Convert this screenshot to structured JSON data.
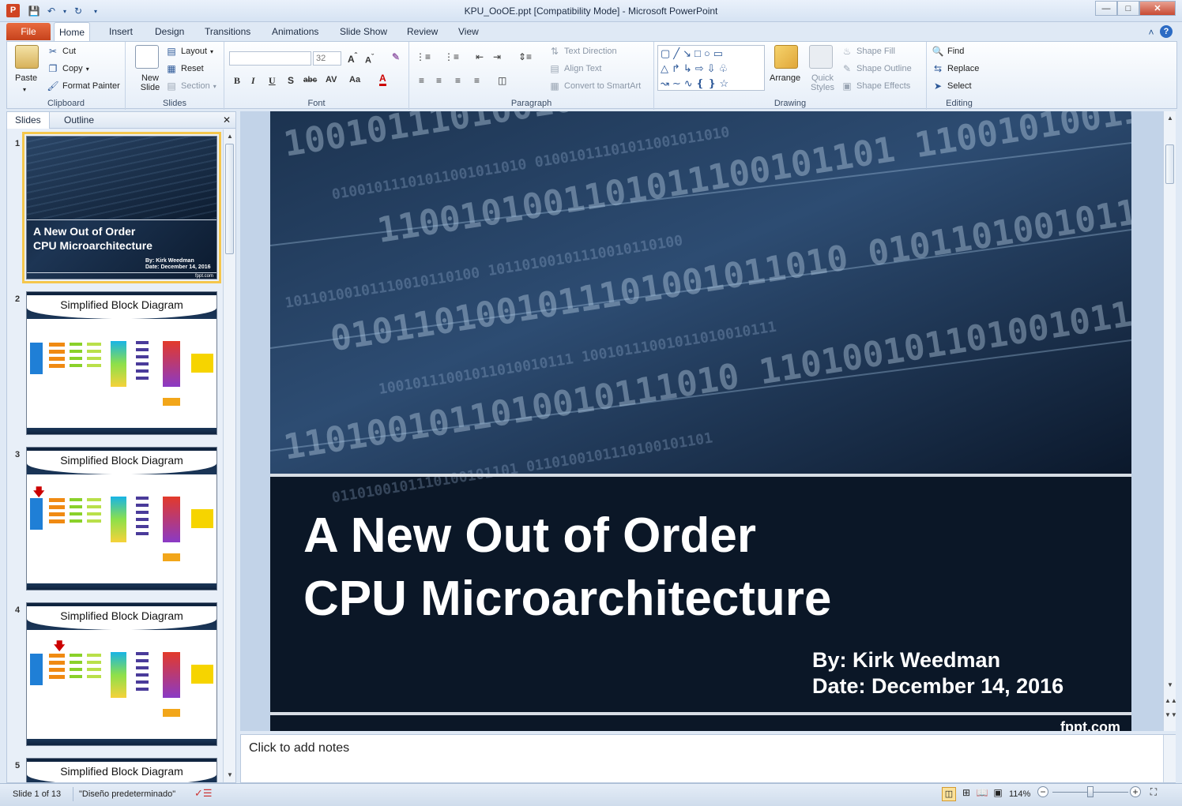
{
  "window": {
    "title": "KPU_OoOE.ppt [Compatibility Mode] - Microsoft PowerPoint",
    "app_letter": "P"
  },
  "tabs": [
    "File",
    "Home",
    "Insert",
    "Design",
    "Transitions",
    "Animations",
    "Slide Show",
    "Review",
    "View"
  ],
  "ribbon": {
    "clipboard": {
      "label": "Clipboard",
      "paste": "Paste",
      "cut": "Cut",
      "copy": "Copy",
      "format_painter": "Format Painter"
    },
    "slides": {
      "label": "Slides",
      "new_slide": "New Slide",
      "layout": "Layout",
      "reset": "Reset",
      "section": "Section"
    },
    "font": {
      "label": "Font",
      "size": "32"
    },
    "paragraph": {
      "label": "Paragraph",
      "text_direction": "Text Direction",
      "align_text": "Align Text",
      "convert_smartart": "Convert to SmartArt"
    },
    "drawing": {
      "label": "Drawing",
      "arrange": "Arrange",
      "quick_styles": "Quick Styles",
      "shape_fill": "Shape Fill",
      "shape_outline": "Shape Outline",
      "shape_effects": "Shape Effects"
    },
    "editing": {
      "label": "Editing",
      "find": "Find",
      "replace": "Replace",
      "select": "Select"
    }
  },
  "left_panel": {
    "tab_slides": "Slides",
    "tab_outline": "Outline",
    "thumbnails": [
      {
        "num": "1",
        "title": "A  New Out of Order",
        "subtitle": "CPU Microarchitecture",
        "by": "By:  Kirk Weedman",
        "date": "Date:  December 14, 2016",
        "brand": "fppt.com"
      },
      {
        "num": "2",
        "title": "Simplified Block Diagram"
      },
      {
        "num": "3",
        "title": "Simplified Block Diagram"
      },
      {
        "num": "4",
        "title": "Simplified Block Diagram"
      },
      {
        "num": "5",
        "title": "Simplified Block Diagram"
      }
    ]
  },
  "slide": {
    "title_line1": "A New Out of Order",
    "title_line2": "CPU Microarchitecture",
    "by": "By: Kirk Weedman",
    "date": "Date: December 14, 2016",
    "brand": "fppt.com",
    "binary_rows": [
      "10010111010010110100101",
      "01001011101011001011010",
      "1100101001101011100101101",
      "10110100101110010110100",
      "0101101001011101001011010",
      "10010111001011010010111",
      "1101001011010010111010",
      "0110100101110100101101"
    ]
  },
  "notes": {
    "placeholder": "Click to add notes"
  },
  "status": {
    "slide": "Slide 1 of 13",
    "theme": "\"Diseño predeterminado\"",
    "zoom": "114%"
  }
}
